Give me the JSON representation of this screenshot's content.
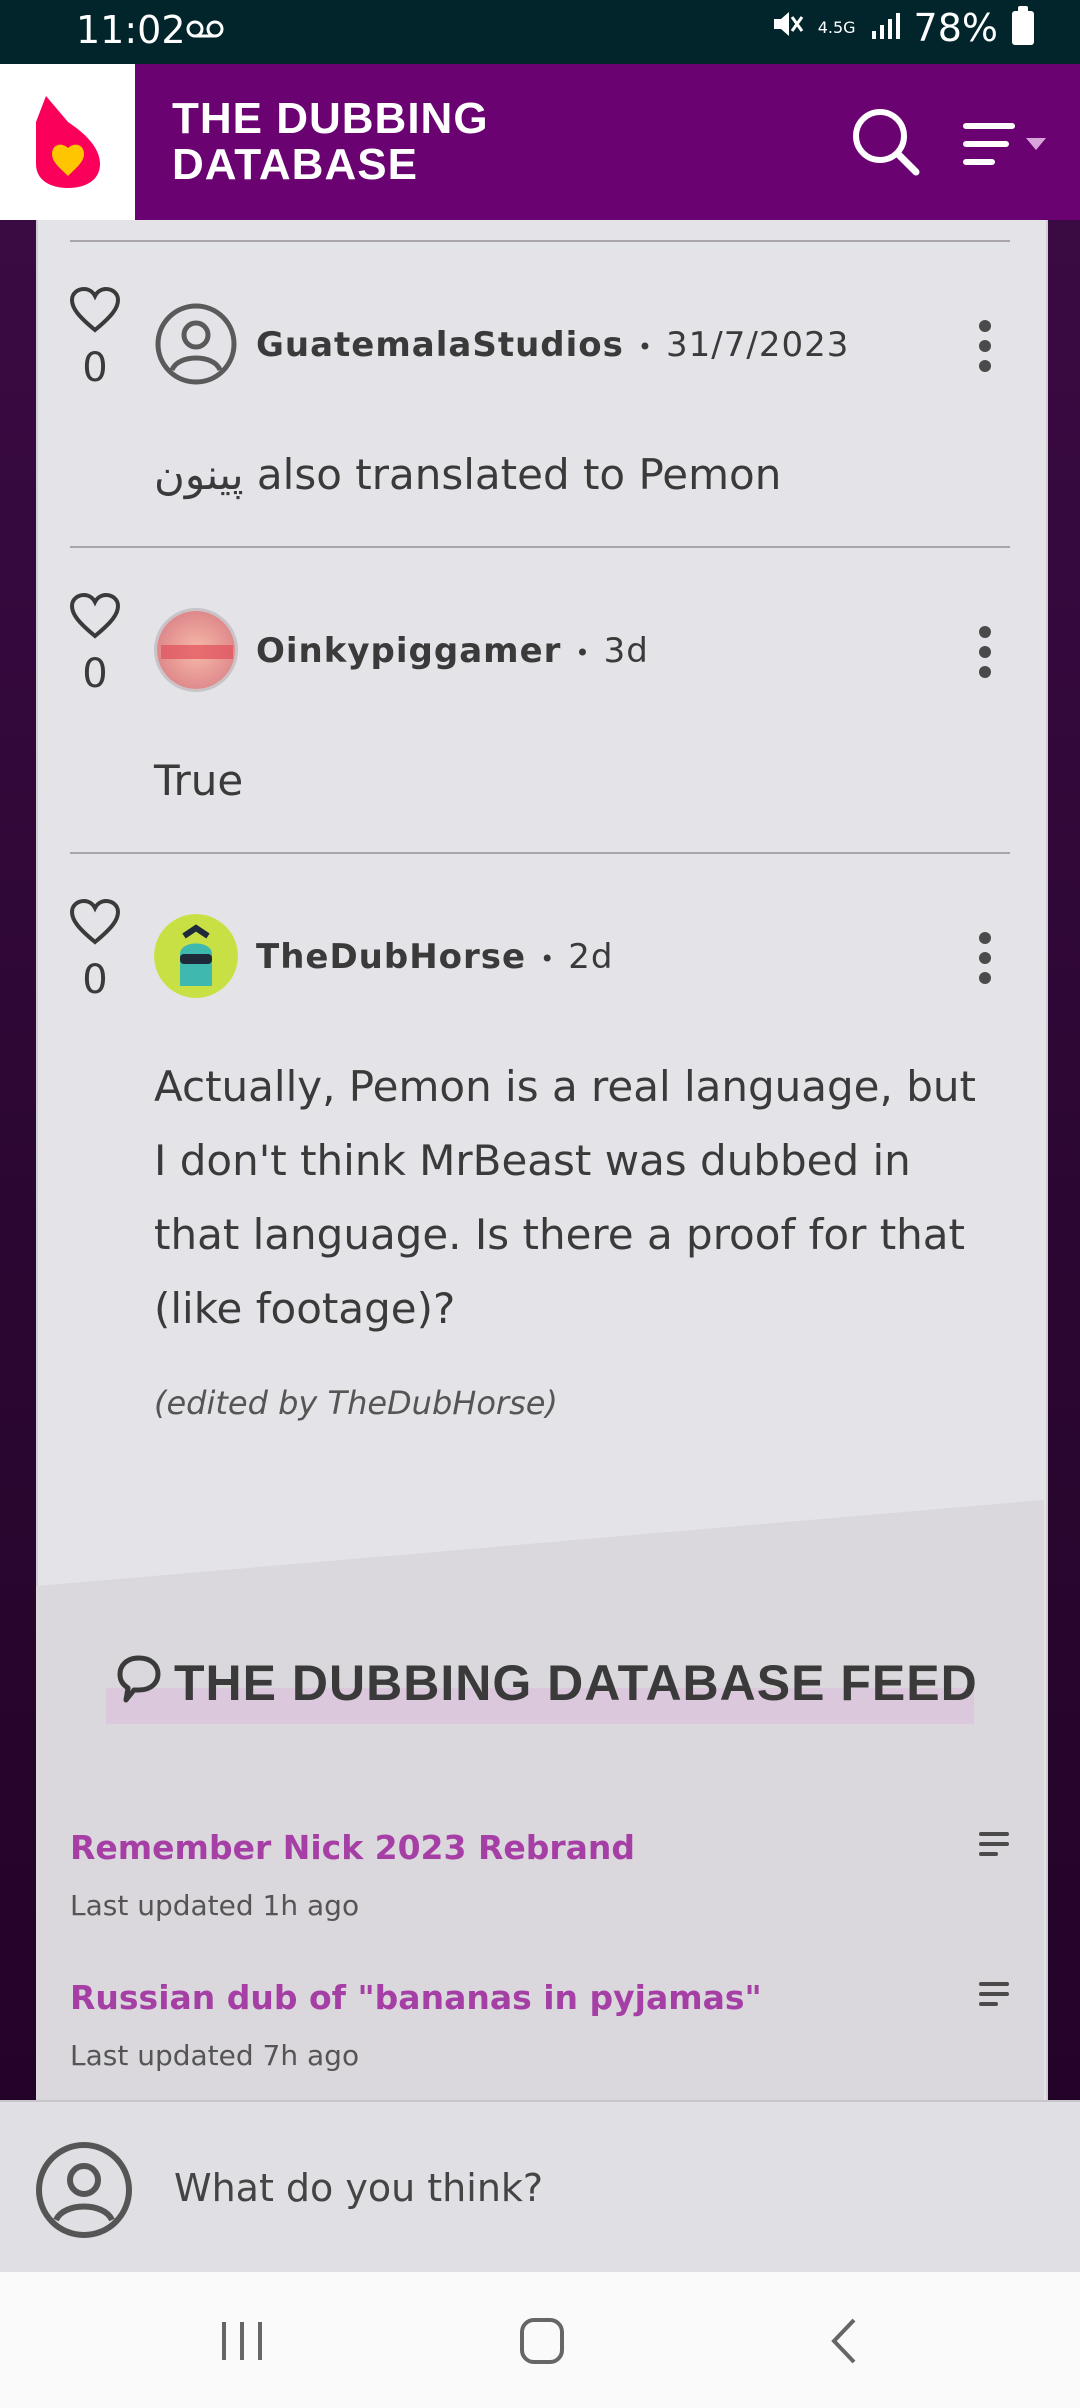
{
  "status_bar": {
    "time": "11:02",
    "voicemail_icon": "voicemail-icon",
    "network": "4.5G",
    "battery": "78%"
  },
  "header": {
    "title_line1": "THE DUBBING",
    "title_line2": "DATABASE",
    "logo": "fandom-logo",
    "search_icon": "search-icon",
    "menu_icon": "menu-icon"
  },
  "comments": [
    {
      "likes": "0",
      "user": "GuatemalaStudios",
      "date": "31/7/2023",
      "text": "پینون also translated to Pemon",
      "edited": ""
    },
    {
      "likes": "0",
      "user": "Oinkypiggamer",
      "date": "3d",
      "text": "True",
      "edited": ""
    },
    {
      "likes": "0",
      "user": "TheDubHorse",
      "date": "2d",
      "text": "Actually, Pemon is a real language, but I don't think MrBeast was dubbed in that language. Is there a proof for that (like footage)?",
      "edited": "(edited by TheDubHorse)"
    }
  ],
  "feed": {
    "title": "THE DUBBING DATABASE FEED",
    "items": [
      {
        "title": "Remember Nick 2023 Rebrand",
        "updated": "Last updated 1h ago"
      },
      {
        "title": "Russian dub of \"bananas in pyjamas\"",
        "updated": "Last updated 7h ago"
      }
    ]
  },
  "composer": {
    "placeholder": "What do you think?"
  },
  "colors": {
    "header_bg": "#6b0272",
    "accent_link": "#a63fa5",
    "status_bar_bg": "#01252b",
    "panel_bg": "#e4e3e7"
  }
}
